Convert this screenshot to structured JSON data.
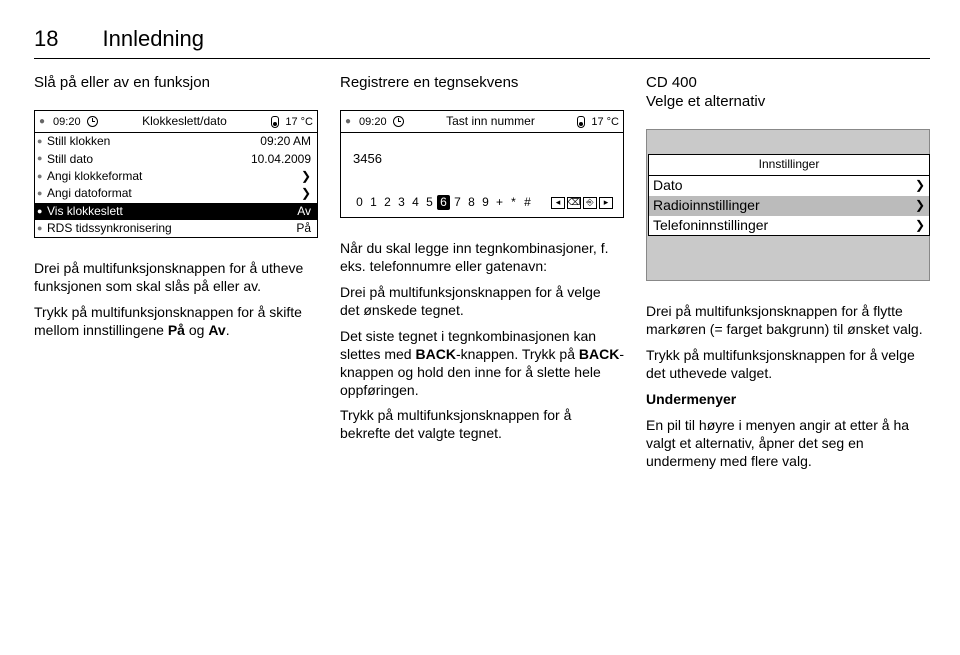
{
  "page_number": "18",
  "page_title": "Innledning",
  "col1": {
    "heading": "Slå på eller av en funksjon",
    "screen": {
      "time": "09:20",
      "status_title": "Klokkeslett/dato",
      "temp": "17 °C",
      "rows": [
        {
          "label": "Still klokken",
          "value": "09:20 AM"
        },
        {
          "label": "Still dato",
          "value": "10.04.2009"
        },
        {
          "label": "Angi klokkeformat",
          "value": "❯"
        },
        {
          "label": "Angi datoformat",
          "value": "❯"
        },
        {
          "label": "Vis klokkeslett",
          "value": "Av",
          "selected": true
        },
        {
          "label": "RDS tidssynkronisering",
          "value": "På"
        }
      ]
    },
    "p1": "Drei på multifunksjonsknappen for å utheve funksjonen som skal slås på eller av.",
    "p2_a": "Trykk på multifunksjonsknappen for å skifte mellom innstillingene ",
    "p2_b": "På",
    "p2_c": " og ",
    "p2_d": "Av",
    "p2_e": "."
  },
  "col2": {
    "heading": "Registrere en tegnsekvens",
    "screen": {
      "time": "09:20",
      "status_title": "Tast inn nummer",
      "temp": "17 °C",
      "entered": "3456",
      "digits": [
        "0",
        "1",
        "2",
        "3",
        "4",
        "5",
        "6",
        "7",
        "8",
        "9",
        "+",
        "*",
        "#"
      ],
      "selected_index": 6,
      "nav_icons": [
        "◂",
        "⌫",
        "⎆",
        "▸"
      ]
    },
    "p1": "Når du skal legge inn tegnkombinasjoner, f. eks. telefonnumre eller gatenavn:",
    "p2": "Drei på multifunksjonsknappen for å velge det ønskede tegnet.",
    "p3_a": "Det siste tegnet i tegnkombinasjonen kan slettes med ",
    "p3_b": "BACK",
    "p3_c": "-knappen. Trykk på ",
    "p3_d": "BACK",
    "p3_e": "-knappen og hold den inne for å slette hele oppføringen.",
    "p4": "Trykk på multifunksjonsknappen for å bekrefte det valgte tegnet."
  },
  "col3": {
    "heading_a": "CD 400",
    "heading_b": "Velge et alternativ",
    "screen": {
      "inner_title": "Innstillinger",
      "rows": [
        {
          "label": "Dato",
          "chev": "❯"
        },
        {
          "label": "Radioinnstillinger",
          "chev": "❯",
          "selected": true
        },
        {
          "label": "Telefoninnstillinger",
          "chev": "❯"
        }
      ]
    },
    "p1": "Drei på multifunksjonsknappen for å flytte markøren (= farget bakgrunn) til ønsket valg.",
    "p2": "Trykk på multifunksjonsknappen for å velge det uthevede valget.",
    "subhead": "Undermenyer",
    "p3": "En pil til høyre i menyen angir at etter å ha valgt et alternativ, åpner det seg en undermeny med flere valg."
  }
}
